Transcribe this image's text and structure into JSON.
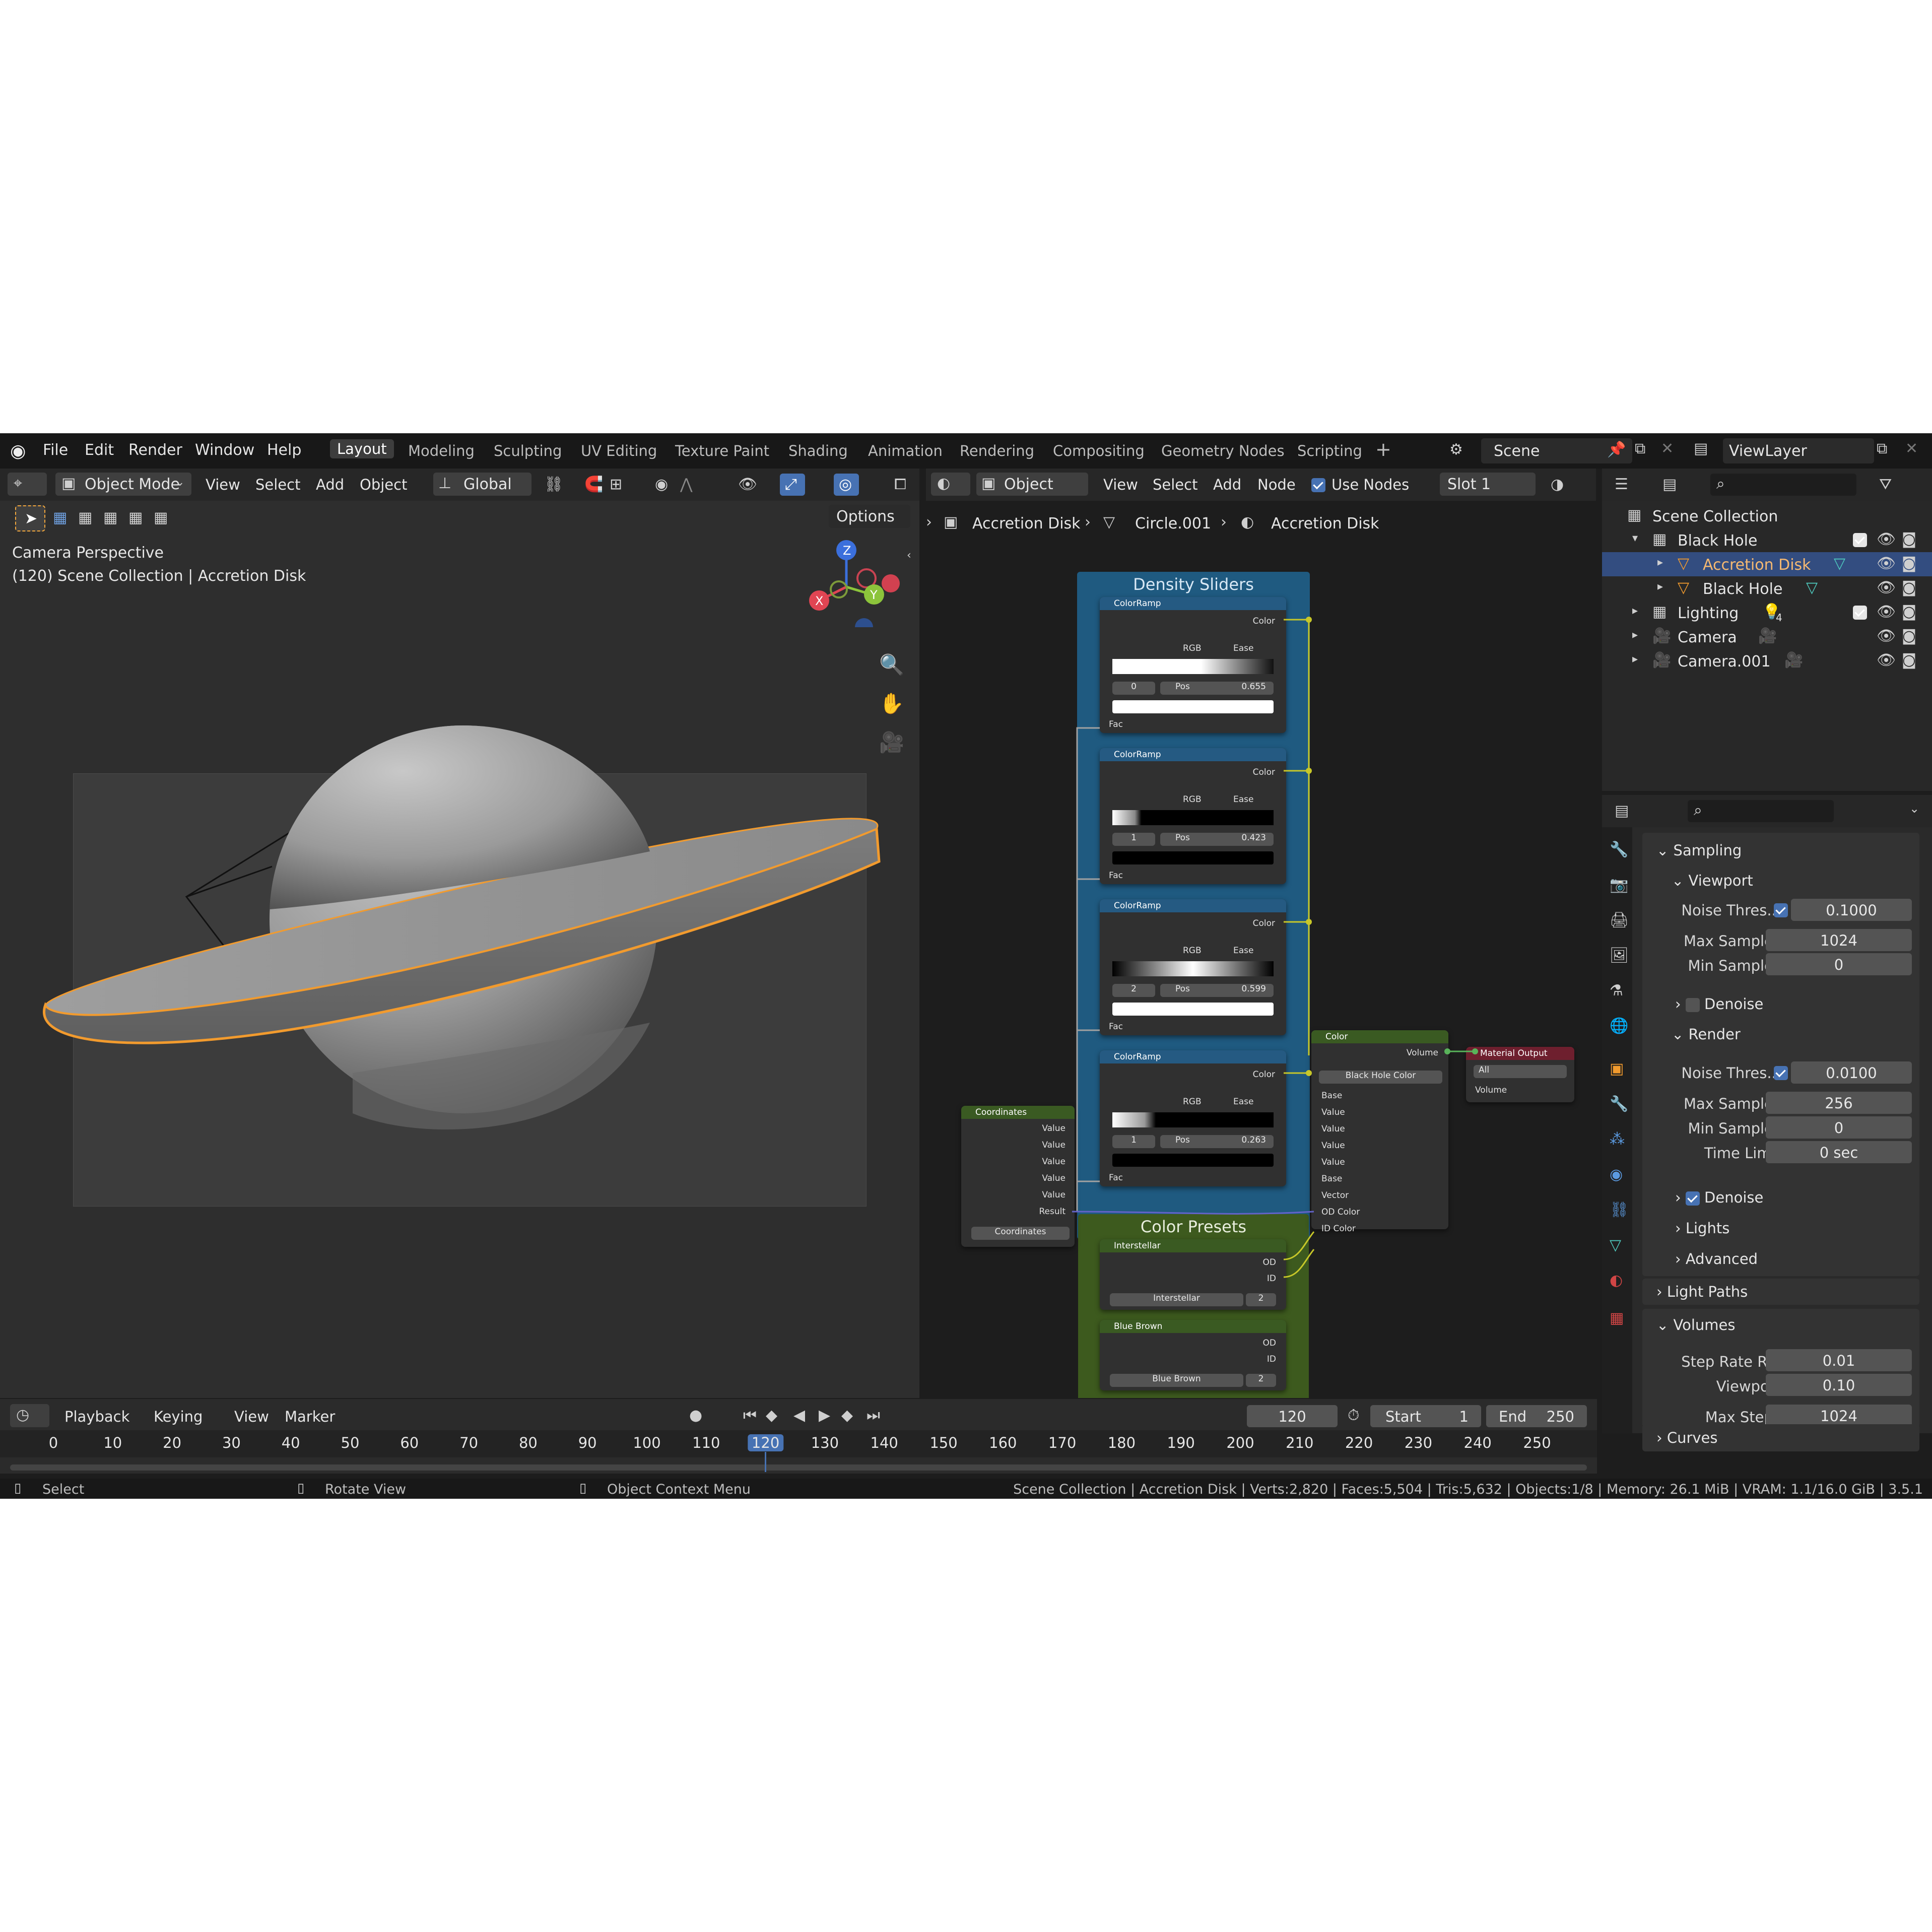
{
  "topbar": {
    "menus": [
      "File",
      "Edit",
      "Render",
      "Window",
      "Help"
    ],
    "workspaces": [
      "Layout",
      "Modeling",
      "Sculpting",
      "UV Editing",
      "Texture Paint",
      "Shading",
      "Animation",
      "Rendering",
      "Compositing",
      "Geometry Nodes",
      "Scripting"
    ],
    "active_workspace": "Layout",
    "add_tab": "+",
    "scene": "Scene",
    "view_layer": "ViewLayer"
  },
  "viewport": {
    "mode": "Object Mode",
    "menus": [
      "View",
      "Select",
      "Add",
      "Object"
    ],
    "orientation": "Global",
    "options": "Options",
    "info_line1": "Camera Perspective",
    "info_line2": "(120) Scene Collection | Accretion Disk",
    "gizmo": {
      "x": "X",
      "y": "Y",
      "z": "Z"
    }
  },
  "node_editor": {
    "type": "Object",
    "menus": [
      "View",
      "Select",
      "Add",
      "Node"
    ],
    "use_nodes": "Use Nodes",
    "slot": "Slot 1",
    "breadcrumb": [
      "Accretion Disk",
      "Circle.001",
      "Accretion Disk"
    ],
    "frame_density": "Density Sliders",
    "frame_presets": "Color Presets",
    "colorramps": [
      {
        "title": "ColorRamp",
        "out": "Color",
        "mode": "RGB",
        "interp": "Ease",
        "index": "0",
        "pos_label": "Pos",
        "pos": "0.655",
        "in": "Fac"
      },
      {
        "title": "ColorRamp",
        "out": "Color",
        "mode": "RGB",
        "interp": "Ease",
        "index": "1",
        "pos_label": "Pos",
        "pos": "0.423",
        "in": "Fac"
      },
      {
        "title": "ColorRamp",
        "out": "Color",
        "mode": "RGB",
        "interp": "Ease",
        "index": "2",
        "pos_label": "Pos",
        "pos": "0.599",
        "in": "Fac"
      },
      {
        "title": "ColorRamp",
        "out": "Color",
        "mode": "RGB",
        "interp": "Ease",
        "index": "1",
        "pos_label": "Pos",
        "pos": "0.263",
        "in": "Fac"
      }
    ],
    "coordinates": {
      "title": "Coordinates",
      "outputs": [
        "Value",
        "Value",
        "Value",
        "Value",
        "Value",
        "Result"
      ],
      "group": "Coordinates"
    },
    "color_node": {
      "title": "Color",
      "out": "Volume",
      "group": "Black Hole Color",
      "inputs": [
        "Base",
        "Value",
        "Value",
        "Value",
        "Value",
        "Base",
        "Vector",
        "OD Color",
        "ID Color"
      ]
    },
    "material_output": {
      "title": "Material Output",
      "target": "All",
      "input": "Volume"
    },
    "presets": [
      {
        "title": "Interstellar",
        "outputs": [
          "OD",
          "ID"
        ],
        "group": "Interstellar",
        "users": "2"
      },
      {
        "title": "Blue Brown",
        "outputs": [
          "OD",
          "ID"
        ],
        "group": "Blue Brown",
        "users": "2"
      }
    ]
  },
  "outliner": {
    "root": "Scene Collection",
    "items": [
      {
        "name": "Black Hole",
        "depth": 1
      },
      {
        "name": "Accretion Disk",
        "depth": 2,
        "selected": true
      },
      {
        "name": "Black Hole",
        "depth": 2
      },
      {
        "name": "Lighting",
        "depth": 1,
        "badge": "4"
      },
      {
        "name": "Camera",
        "depth": 1
      },
      {
        "name": "Camera.001",
        "depth": 1
      }
    ]
  },
  "properties": {
    "sampling": "Sampling",
    "viewport": "Viewport",
    "vp_noise_label": "Noise Thres...",
    "vp_noise": "0.1000",
    "vp_max_label": "Max Samples",
    "vp_max": "1024",
    "vp_min_label": "Min Samples",
    "vp_min": "0",
    "vp_denoise": "Denoise",
    "render": "Render",
    "r_noise_label": "Noise Thres...",
    "r_noise": "0.0100",
    "r_max_label": "Max Samples",
    "r_max": "256",
    "r_min_label": "Min Samples",
    "r_min": "0",
    "r_time_label": "Time Limit",
    "r_time": "0 sec",
    "r_denoise": "Denoise",
    "lights": "Lights",
    "advanced": "Advanced",
    "light_paths": "Light Paths",
    "volumes": "Volumes",
    "step_rate_label": "Step Rate R...",
    "step_rate": "0.01",
    "vol_viewport_label": "Viewport",
    "vol_viewport": "0.10",
    "max_steps_label": "Max Steps",
    "max_steps": "1024",
    "curves": "Curves"
  },
  "timeline": {
    "menus": [
      "Playback",
      "Keying",
      "View",
      "Marker"
    ],
    "current_frame": "120",
    "start_label": "Start",
    "start": "1",
    "end_label": "End",
    "end": "250",
    "ticks": [
      "0",
      "10",
      "20",
      "30",
      "40",
      "50",
      "60",
      "70",
      "80",
      "90",
      "100",
      "110",
      "120",
      "130",
      "140",
      "150",
      "160",
      "170",
      "180",
      "190",
      "200",
      "210",
      "220",
      "230",
      "240",
      "250"
    ]
  },
  "statusbar": {
    "select": "Select",
    "rotate": "Rotate View",
    "context": "Object Context Menu",
    "stats": "Scene Collection | Accretion Disk | Verts:2,820 | Faces:5,504 | Tris:5,632 | Objects:1/8 | Memory: 26.1 MiB | VRAM: 1.1/16.0 GiB | 3.5.1"
  },
  "colors": {
    "accent": "#4772b3",
    "selection_outline": "#f29b2e",
    "frame_blue": "#1f5a80",
    "frame_green": "#3d5a1e",
    "socket_yellow": "#c7c729",
    "socket_gray": "#a1a1a1",
    "socket_purple": "#6363c7"
  }
}
